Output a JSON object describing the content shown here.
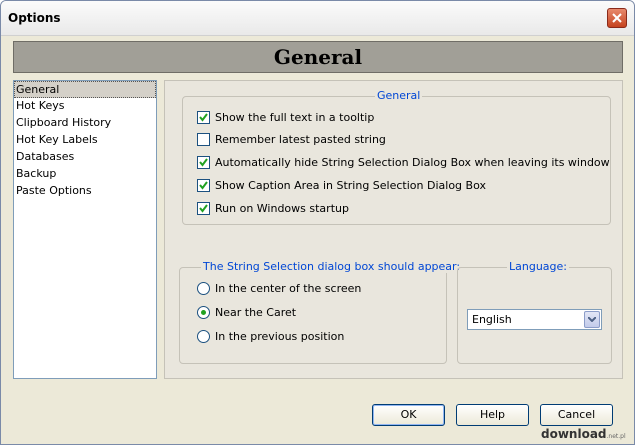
{
  "window": {
    "title": "Options"
  },
  "header": {
    "title": "General"
  },
  "sidebar": {
    "items": [
      {
        "label": "General",
        "selected": true
      },
      {
        "label": "Hot Keys",
        "selected": false
      },
      {
        "label": "Clipboard History",
        "selected": false
      },
      {
        "label": "Hot Key Labels",
        "selected": false
      },
      {
        "label": "Databases",
        "selected": false
      },
      {
        "label": "Backup",
        "selected": false
      },
      {
        "label": "Paste Options",
        "selected": false
      }
    ]
  },
  "general_group": {
    "title": "General",
    "options": [
      {
        "label": "Show the full text in a tooltip",
        "checked": true
      },
      {
        "label": "Remember latest pasted string",
        "checked": false
      },
      {
        "label": "Automatically hide String Selection Dialog Box when leaving its window",
        "checked": true
      },
      {
        "label": "Show Caption Area in String Selection Dialog Box",
        "checked": true
      },
      {
        "label": "Run on Windows startup",
        "checked": true
      }
    ]
  },
  "position_group": {
    "title": "The String Selection dialog box should appear:",
    "options": [
      {
        "label": "In the center of the screen",
        "selected": false
      },
      {
        "label": "Near the Caret",
        "selected": true
      },
      {
        "label": "In the previous position",
        "selected": false
      }
    ]
  },
  "language_group": {
    "title": "Language:",
    "selected": "English"
  },
  "buttons": {
    "ok": "OK",
    "help": "Help",
    "cancel": "Cancel"
  },
  "watermark": {
    "text": "download",
    "suffix": ".net.pl"
  },
  "colors": {
    "group_title": "#0046d5",
    "check": "#21a121",
    "header_bg": "#a19f97"
  }
}
